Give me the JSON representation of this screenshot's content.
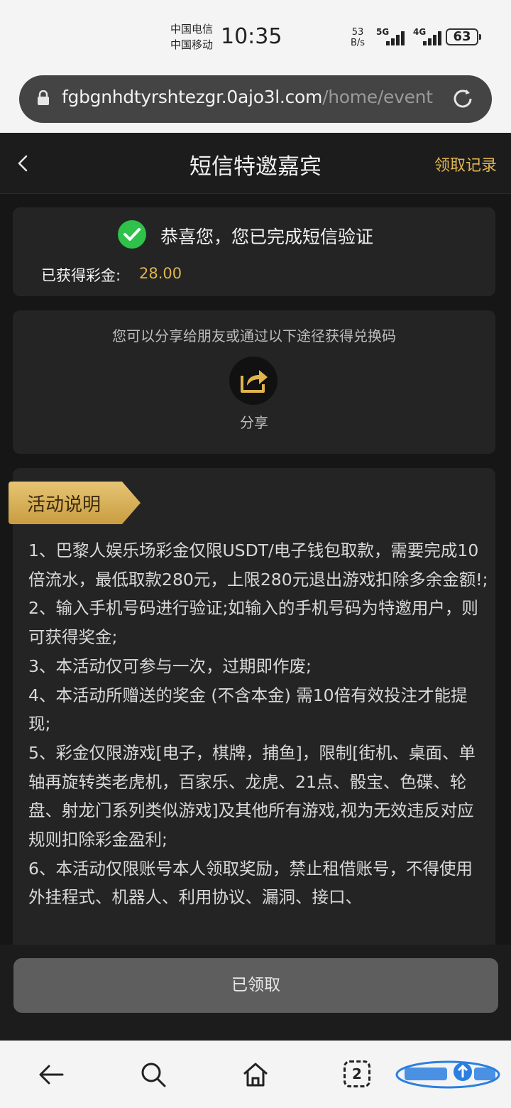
{
  "status_bar": {
    "carrier_1": "中国电信",
    "carrier_2": "中国移动",
    "time": "10:35",
    "speed_value": "53",
    "speed_unit": "B/s",
    "signal_1": "5G",
    "signal_2": "4G",
    "battery": "63"
  },
  "browser": {
    "url_domain": "fgbgnhdtyrshtezgr.0ajo3l.com",
    "url_path": "/home/event",
    "tabs_count": "2"
  },
  "nav": {
    "title": "短信特邀嘉宾",
    "right_link": "领取记录"
  },
  "verify_card": {
    "message": "恭喜您，您已完成短信验证",
    "reward_label": "已获得彩金:",
    "reward_value": "28.00"
  },
  "share_card": {
    "hint": "您可以分享给朋友或通过以下途径获得兑换码",
    "share_label": "分享"
  },
  "rules": {
    "title": "活动说明",
    "items": [
      "1、巴黎人娱乐场彩金仅限USDT/电子钱包取款，需要完成10倍流水，最低取款280元，上限280元退出游戏扣除多余金额!;",
      "2、输入手机号码进行验证;如输入的手机号码为特邀用户，则可获得奖金;",
      "3、本活动仅可参与一次，过期即作废;",
      "4、本活动所赠送的奖金 (不含本金) 需10倍有效投注才能提现;",
      "5、彩金仅限游戏[电子，棋牌，捕鱼]，限制[街机、桌面、单轴再旋转类老虎机，百家乐、龙虎、21点、骰宝、色碟、轮盘、射龙门系列类似游戏]及其他所有游戏,视为无效违反对应规则扣除彩金盈利;",
      "6、本活动仅限账号本人领取奖励，禁止租借账号，不得使用外挂程式、机器人、利用协议、漏洞、接口、"
    ]
  },
  "bottom": {
    "claimed_button": "已领取"
  },
  "colors": {
    "accent_gold": "#e0b44e",
    "success_green": "#2fc24a",
    "page_bg": "#161616",
    "card_bg": "#242424"
  },
  "icons": [
    "lock-icon",
    "reload-icon",
    "back-icon",
    "check-icon",
    "share-icon",
    "back-arrow-icon",
    "search-icon",
    "home-icon",
    "tabs-icon"
  ]
}
